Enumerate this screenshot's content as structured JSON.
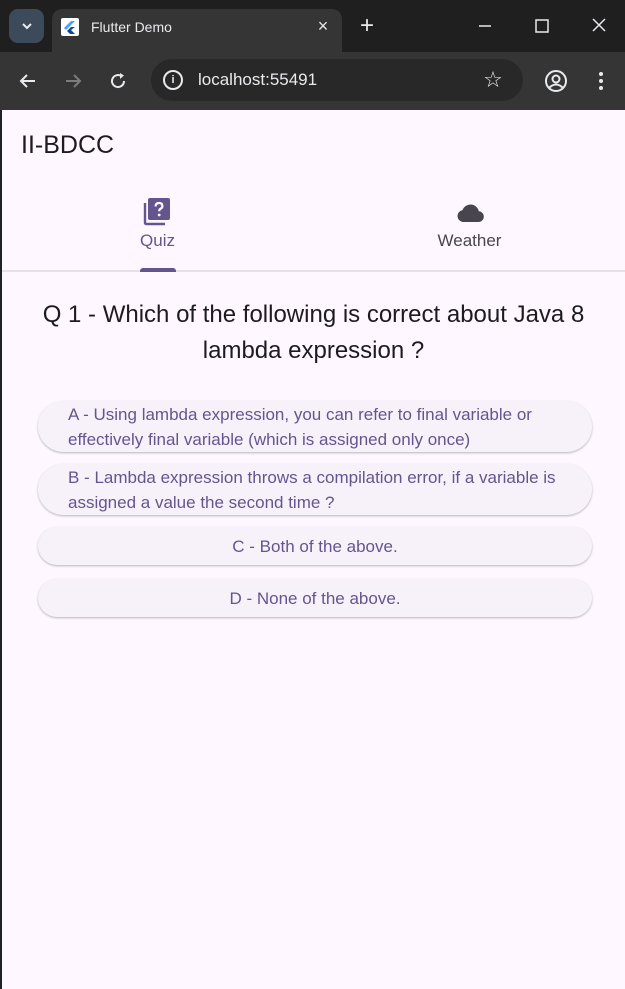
{
  "browser": {
    "tab_title": "Flutter Demo",
    "tab_close_glyph": "×",
    "new_tab_glyph": "+",
    "url": "localhost:55491",
    "icons": [
      "tab-search-icon",
      "flutter-icon",
      "back-icon",
      "forward-icon",
      "reload-icon",
      "info-icon",
      "star-icon",
      "profile-icon",
      "more-vert-icon",
      "minimize-icon",
      "maximize-icon",
      "close-window-icon"
    ]
  },
  "app": {
    "title": "II-BDCC",
    "tabs": [
      {
        "label": "Quiz",
        "icon": "quiz-icon",
        "selected": true
      },
      {
        "label": "Weather",
        "icon": "cloud-icon",
        "selected": false
      }
    ],
    "question": "Q 1 - Which of the following is correct about Java 8 lambda expression ?",
    "answers": [
      "A - Using lambda expression, you can refer to final variable or effectively final variable (which is assigned only once)",
      "B - Lambda expression throws a compilation error, if a variable is assigned a value the second time ?",
      "C - Both of the above.",
      "D - None of the above."
    ]
  },
  "colors": {
    "primary": "#65558f",
    "background": "#fef7ff",
    "button_surface": "#f7f2fa",
    "on_surface": "#1d1b20"
  }
}
